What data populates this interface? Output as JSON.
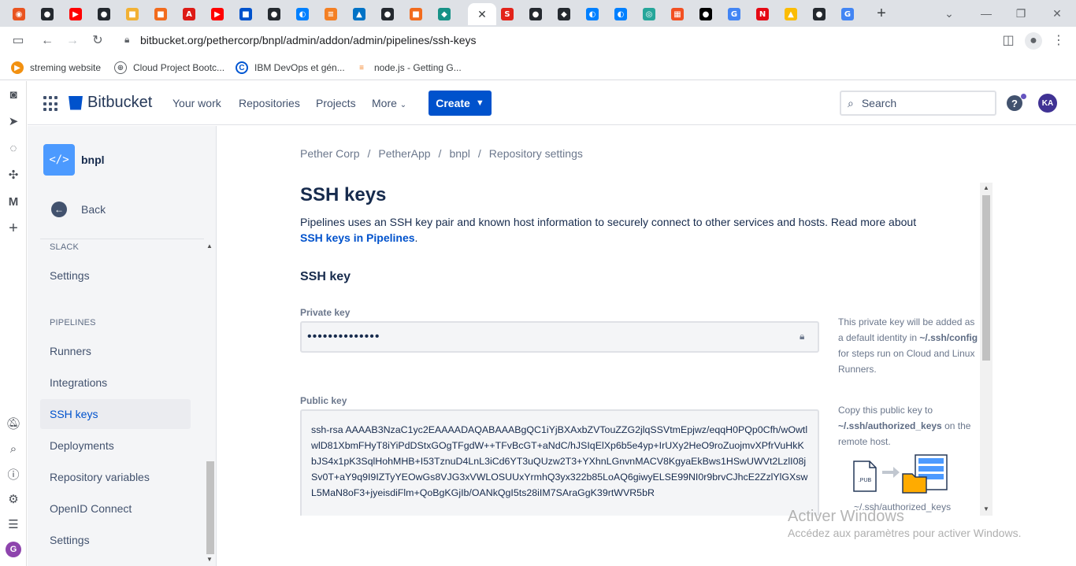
{
  "browser": {
    "tabs": [
      {
        "icon": "ubuntu-icon",
        "color": "#e95420",
        "glyph": "◉"
      },
      {
        "icon": "github-icon",
        "color": "#24292f",
        "glyph": "●"
      },
      {
        "icon": "youtube-icon",
        "color": "#ff0000",
        "glyph": "▶"
      },
      {
        "icon": "github-icon",
        "color": "#24292f",
        "glyph": "●"
      },
      {
        "icon": "box-icon",
        "color": "#f2b134",
        "glyph": "■"
      },
      {
        "icon": "package-icon",
        "color": "#f26b1d",
        "glyph": "■"
      },
      {
        "icon": "angular-icon",
        "color": "#dd1b16",
        "glyph": "A"
      },
      {
        "icon": "youtube-icon",
        "color": "#ff0000",
        "glyph": "▶"
      },
      {
        "icon": "bitbucket-icon",
        "color": "#0052cc",
        "glyph": "■"
      },
      {
        "icon": "github-icon",
        "color": "#24292f",
        "glyph": "●"
      },
      {
        "icon": "digitalocean-icon",
        "color": "#0080ff",
        "glyph": "◐"
      },
      {
        "icon": "stackoverflow-icon",
        "color": "#f48024",
        "glyph": "≡"
      },
      {
        "icon": "azure-icon",
        "color": "#0072c6",
        "glyph": "▲"
      },
      {
        "icon": "github-icon",
        "color": "#24292f",
        "glyph": "●"
      },
      {
        "icon": "package-icon",
        "color": "#f26b1d",
        "glyph": "■"
      },
      {
        "icon": "gitkraken-icon",
        "color": "#179287",
        "glyph": "◆"
      }
    ],
    "tabs_right": [
      {
        "icon": "red-s-icon",
        "color": "#e2231a",
        "glyph": "S"
      },
      {
        "icon": "github-icon",
        "color": "#24292f",
        "glyph": "●"
      },
      {
        "icon": "gitkraken-icon",
        "color": "#24292f",
        "glyph": "◆"
      },
      {
        "icon": "digitalocean-icon",
        "color": "#0080ff",
        "glyph": "◐"
      },
      {
        "icon": "digitalocean-icon",
        "color": "#0080ff",
        "glyph": "◐"
      },
      {
        "icon": "eye-icon",
        "color": "#26a69a",
        "glyph": "◎"
      },
      {
        "icon": "microsoft-icon",
        "color": "#f25022",
        "glyph": "▦"
      },
      {
        "icon": "medium-icon",
        "color": "#000000",
        "glyph": "●"
      },
      {
        "icon": "google-icon",
        "color": "#4285f4",
        "glyph": "G"
      },
      {
        "icon": "netflix-icon",
        "color": "#e50914",
        "glyph": "N"
      },
      {
        "icon": "drive-icon",
        "color": "#fbbc04",
        "glyph": "▲"
      },
      {
        "icon": "github-icon",
        "color": "#24292f",
        "glyph": "●"
      },
      {
        "icon": "google-icon",
        "color": "#4285f4",
        "glyph": "G"
      }
    ],
    "url": "bitbucket.org/pethercorp/bnpl/admin/addon/admin/pipelines/ssh-keys",
    "bookmarks": [
      {
        "label": "streming website",
        "icon": "play-icon",
        "color": "#f29111"
      },
      {
        "label": "Cloud Project Bootc...",
        "icon": "globe-icon",
        "color": "#5f6368"
      },
      {
        "label": "IBM DevOps et gén...",
        "icon": "coursera-icon",
        "color": "#0056d2"
      },
      {
        "label": "node.js - Getting G...",
        "icon": "stackoverflow-icon",
        "color": "#f48024"
      }
    ]
  },
  "header": {
    "brand": "Bitbucket",
    "nav": [
      "Your work",
      "Repositories",
      "Projects",
      "More"
    ],
    "create_label": "Create",
    "search_placeholder": "Search",
    "avatar_initials": "KA"
  },
  "sidebar": {
    "repo_name": "bnpl",
    "back_label": "Back",
    "sections": [
      {
        "title": "SLACK",
        "items": [
          "Settings"
        ]
      },
      {
        "title": "PIPELINES",
        "items": [
          "Runners",
          "Integrations",
          "SSH keys",
          "Deployments",
          "Repository variables",
          "OpenID Connect",
          "Settings"
        ]
      }
    ],
    "selected": "SSH keys"
  },
  "main": {
    "breadcrumb": [
      "Pether Corp",
      "PetherApp",
      "bnpl",
      "Repository settings"
    ],
    "title": "SSH keys",
    "intro_text": "Pipelines uses an SSH key pair and known host information to securely connect to other services and hosts. Read more about",
    "intro_link": "SSH keys in Pipelines",
    "section_title": "SSH key",
    "private_key_label": "Private key",
    "private_key_value": "••••••••••••••",
    "private_hint_pre": "This private key will be added as a default identity in",
    "private_hint_path": "~/.ssh/config",
    "private_hint_post": "for steps run on Cloud and Linux Runners.",
    "public_key_label": "Public key",
    "public_key_value": "ssh-rsa AAAAB3NzaC1yc2EAAAADAQABAAABgQC1iYjBXAxbZVTouZZG2jlqSSVtmEpjwz/eqqH0PQp0Cfh/wOwtlwlD81XbmFHyT8iYiPdDStxGOgTFgdW++TFvBcGT+aNdC/hJSIqElXp6b5e4yp+IrUXy2HeO9roZuojmvXPfrVuHkKbJS4x1pK3SqlHohMHB+I53TznuD4LnL3iCd6YT3uQUzw2T3+YXhnLGnvnMACV8KgyaEkBws1HSwUWVt2LzlI08jSv0T+aY9q9I9IZTyYEOwGs8VJG3xVWLOSUUxYrmhQ3yx322b85LoAQ6giwyELSE99NI0r9brvCJhcE2ZzlYlGXswL5MaN8oF3+jyeisdiFlm+QoBgKGjIb/OANkQgI5ts28iIM7SAraGgK39rtWVR5bR",
    "public_hint_pre": "Copy this public key to",
    "public_hint_path": "~/.ssh/authorized_keys",
    "public_hint_post": "on the remote host.",
    "illustration_caption": "~/.ssh/authorized_keys",
    "illustration_file_label": ".PUB"
  },
  "watermark": {
    "line1": "Activer Windows",
    "line2": "Accédez aux paramètres pour activer Windows."
  },
  "colors": {
    "brand": "#0052cc",
    "selected_bg": "#ebecf0",
    "avatar": "#403294"
  }
}
